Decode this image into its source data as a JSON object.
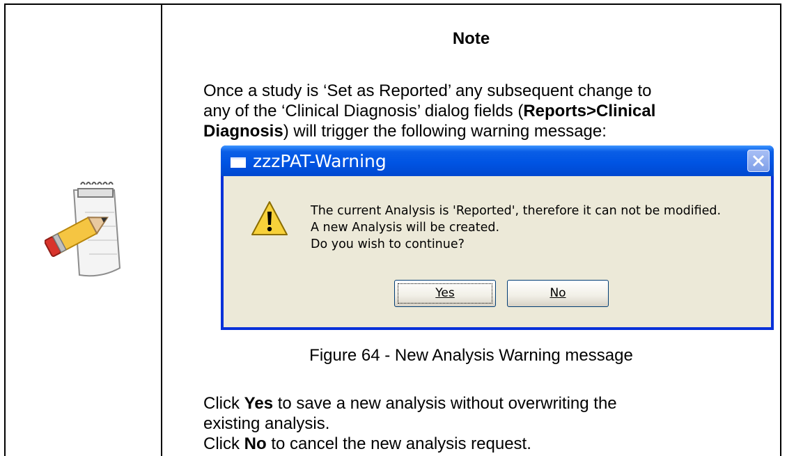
{
  "note": {
    "title": "Note",
    "intro_1": "Once a study is ‘Set as Reported’ any subsequent change to",
    "intro_2": "any of the ‘Clinical Diagnosis’ dialog fields (",
    "intro_bold_1": "Reports>Clinical",
    "intro_bold_2": "Diagnosis",
    "intro_3": ") will trigger the following warning message:"
  },
  "dialog": {
    "title": "zzzPAT-Warning",
    "message_line_1": "The current Analysis is 'Reported', therefore it can not be modified.",
    "message_line_2": "A new  Analysis will be created.",
    "message_line_3": "Do you wish to continue?",
    "yes_label": "Yes",
    "no_label": "No",
    "icons": {
      "title": "window-icon",
      "close": "close-icon",
      "warning": "warning-icon"
    }
  },
  "caption": "Figure 64 - New Analysis Warning message",
  "instructions": {
    "yes_pre": "Click ",
    "yes_bold": "Yes",
    "yes_post_1": " to save a new analysis without overwriting the",
    "yes_post_2": "existing analysis.",
    "no_pre": "Click ",
    "no_bold": "No",
    "no_post": " to cancel the new analysis request."
  },
  "colors": {
    "titlebar": "#0054e3",
    "dialog_body": "#ece9d8",
    "warning_yellow": "#f7d13a"
  }
}
